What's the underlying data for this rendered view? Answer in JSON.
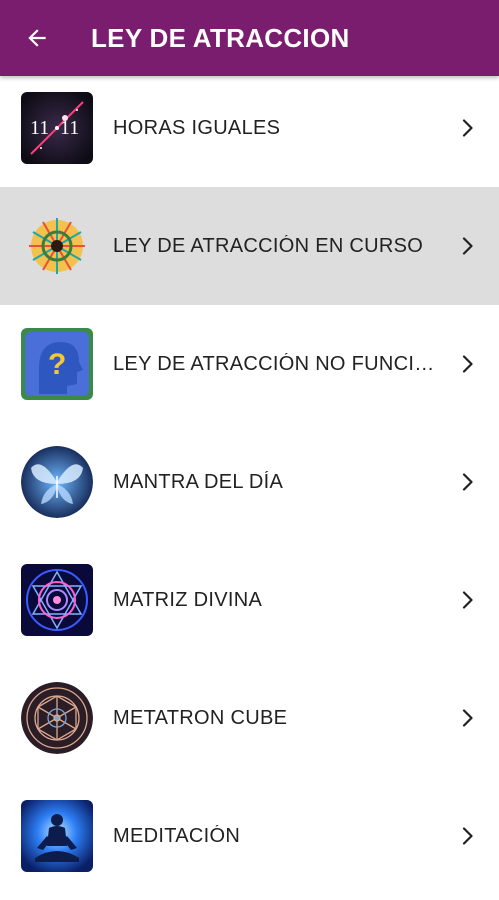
{
  "appbar": {
    "title": "LEY DE ATRACCION",
    "back_icon": "arrow-left-icon",
    "color": "#7a1d6f"
  },
  "items": [
    {
      "label": "HORAS IGUALES",
      "icon": "clock-11-11-icon"
    },
    {
      "label": "LEY DE ATRACCIÓN EN CURSO",
      "icon": "mandala-burst-icon",
      "selected": true
    },
    {
      "label": "LEY DE ATRACCIÓN NO FUNCIONA",
      "icon": "question-head-icon"
    },
    {
      "label": "MANTRA DEL DÍA",
      "icon": "butterfly-icon"
    },
    {
      "label": "MATRIZ DIVINA",
      "icon": "sacred-geometry-icon"
    },
    {
      "label": "METATRON CUBE",
      "icon": "metatron-cube-icon"
    },
    {
      "label": "MEDITACIÓN",
      "icon": "meditation-icon"
    }
  ],
  "selected_row_color": "#dddddd"
}
